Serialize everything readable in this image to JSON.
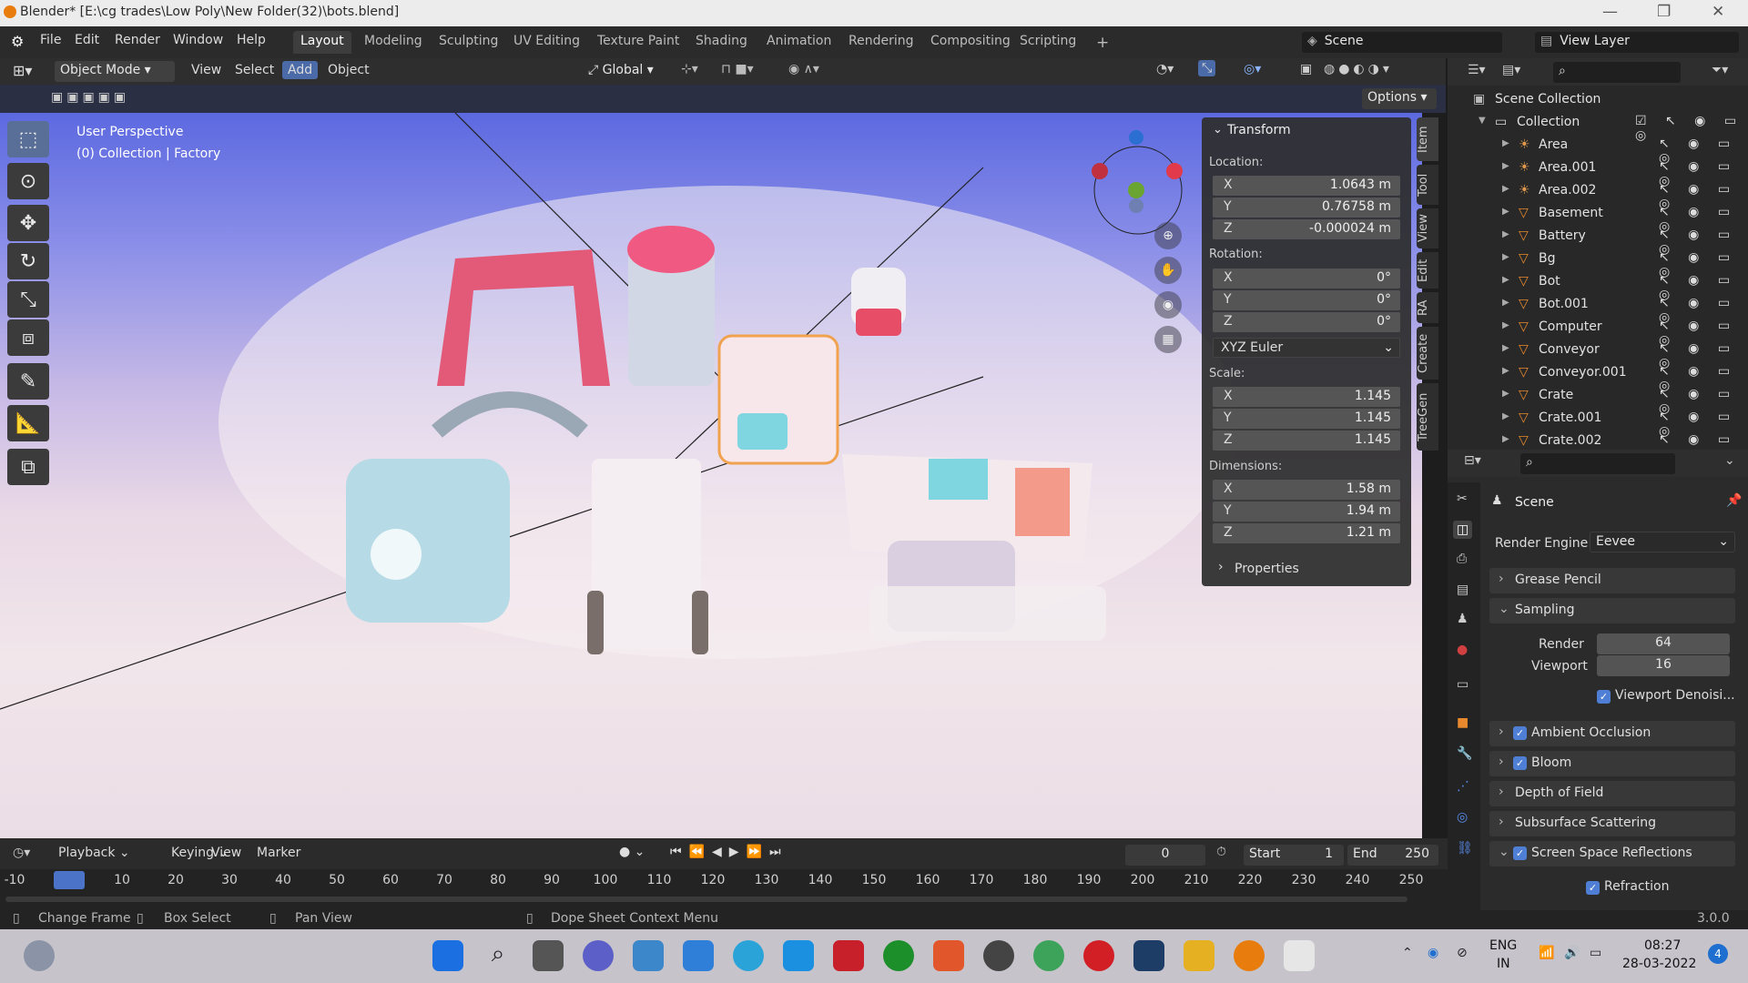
{
  "title": "Blender* [E:\\cg trades\\Low Poly\\New Folder(32)\\bots.blend]",
  "menu": [
    "File",
    "Edit",
    "Render",
    "Window",
    "Help"
  ],
  "workspaces": [
    "Layout",
    "Modeling",
    "Sculpting",
    "UV Editing",
    "Texture Paint",
    "Shading",
    "Animation",
    "Rendering",
    "Compositing",
    "Scripting"
  ],
  "workspace_add": "+",
  "scene_name": "Scene",
  "view_layer": "View Layer",
  "header": {
    "mode": "Object Mode",
    "view": "View",
    "select": "Select",
    "add": "Add",
    "object": "Object",
    "orientation": "Global",
    "options": "Options"
  },
  "viewport": {
    "perspective": "User Perspective",
    "collection": "(0) Collection | Factory"
  },
  "transform": {
    "title": "Transform",
    "location_label": "Location:",
    "location": [
      {
        "axis": "X",
        "value": "1.0643 m"
      },
      {
        "axis": "Y",
        "value": "0.76758 m"
      },
      {
        "axis": "Z",
        "value": "-0.000024 m"
      }
    ],
    "rotation_label": "Rotation:",
    "rotation": [
      {
        "axis": "X",
        "value": "0°"
      },
      {
        "axis": "Y",
        "value": "0°"
      },
      {
        "axis": "Z",
        "value": "0°"
      }
    ],
    "rotation_mode": "XYZ Euler",
    "scale_label": "Scale:",
    "scale": [
      {
        "axis": "X",
        "value": "1.145"
      },
      {
        "axis": "Y",
        "value": "1.145"
      },
      {
        "axis": "Z",
        "value": "1.145"
      }
    ],
    "dimensions_label": "Dimensions:",
    "dimensions": [
      {
        "axis": "X",
        "value": "1.58 m"
      },
      {
        "axis": "Y",
        "value": "1.94 m"
      },
      {
        "axis": "Z",
        "value": "1.21 m"
      }
    ],
    "properties": "Properties"
  },
  "side_tabs": [
    "Item",
    "Tool",
    "View",
    "Edit",
    "RA",
    "Create",
    "TreeGen"
  ],
  "outliner": {
    "root": "Scene Collection",
    "collection": "Collection",
    "items": [
      "Area",
      "Area.001",
      "Area.002",
      "Basement",
      "Battery",
      "Bg",
      "Bot",
      "Bot.001",
      "Computer",
      "Conveyor",
      "Conveyor.001",
      "Crate",
      "Crate.001",
      "Crate.002"
    ]
  },
  "properties": {
    "scene": "Scene",
    "render_engine_label": "Render Engine",
    "render_engine": "Eevee",
    "grease_pencil": "Grease Pencil",
    "sampling": "Sampling",
    "render_label": "Render",
    "render_value": "64",
    "viewport_label": "Viewport",
    "viewport_value": "16",
    "viewport_denoise": "Viewport Denoisi...",
    "ambient_occlusion": "Ambient Occlusion",
    "bloom": "Bloom",
    "depth_of_field": "Depth of Field",
    "subsurface": "Subsurface Scattering",
    "ssr": "Screen Space Reflections",
    "refraction": "Refraction"
  },
  "timeline": {
    "playback": "Playback",
    "keying": "Keying",
    "view": "View",
    "marker": "Marker",
    "current_frame": "0",
    "start_label": "Start",
    "start": "1",
    "end_label": "End",
    "end": "250",
    "ticks": [
      "-10",
      "0",
      "10",
      "20",
      "30",
      "40",
      "50",
      "60",
      "70",
      "80",
      "90",
      "100",
      "110",
      "120",
      "130",
      "140",
      "150",
      "160",
      "170",
      "180",
      "190",
      "200",
      "210",
      "220",
      "230",
      "240",
      "250"
    ]
  },
  "status": {
    "change_frame": "Change Frame",
    "box_select": "Box Select",
    "pan_view": "Pan View",
    "context_menu": "Dope Sheet Context Menu",
    "version": "3.0.0"
  },
  "taskbar": {
    "lang1": "ENG",
    "lang2": "IN",
    "time": "08:27",
    "date": "28-03-2022",
    "notif": "4"
  }
}
